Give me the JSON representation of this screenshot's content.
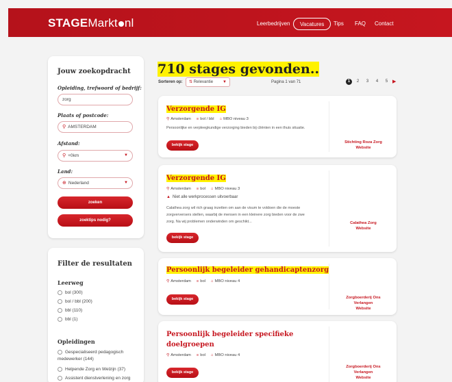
{
  "header": {
    "logo_bold": "STAGE",
    "logo_thin": "Markt",
    "logo_suffix": "nl",
    "nav": [
      "Leerbedrijven",
      "Vacatures",
      "Tips",
      "FAQ",
      "Contact"
    ]
  },
  "search": {
    "title": "Jouw zoekopdracht",
    "q_label": "Opleiding, trefwoord of bedrijf:",
    "q_value": "zorg",
    "place_label": "Plaats of postcode:",
    "place_value": "AMSTERDAM",
    "dist_label": "Afstand:",
    "dist_value": "+0km",
    "country_label": "Land:",
    "country_value": "Nederland",
    "search_btn": "zoeken",
    "tips_btn": "zoektips nodig?"
  },
  "filter": {
    "title": "Filter de resultaten",
    "leerweg_title": "Leerweg",
    "leerweg": [
      "bol (300)",
      "bol / bbl (200)",
      "bbl (110)",
      "bbl (1)"
    ],
    "opleidingen_title": "Opleidingen",
    "opleidingen": [
      "Gespecialiseerd pedagogisch medewerker (144)",
      "Helpende Zorg en Welzijn (37)",
      "Assistent dienstverlening en zorg"
    ]
  },
  "results": {
    "count_title": "710 stages gevonden..",
    "sort_label": "Sorteren op:",
    "sort_value": "Relevantie",
    "pagina": "Pagina 1 van 71",
    "pages": [
      "1",
      "2",
      "3",
      "4",
      "5"
    ],
    "next": "▶"
  },
  "cards": [
    {
      "title": "Verzorgende IG",
      "city": "Amsterdam",
      "leerweg": "bol / bbl",
      "niveau": "MBO niveau 3",
      "desc": "Persoonlijke en verpleegkundige verzorging bieden bij cliënten in een thuis situatie.",
      "btn": "bekijk stage",
      "org1": "Stichting Roza Zorg",
      "org2": "Website"
    },
    {
      "title": "Verzorgende IG",
      "city": "Amsterdam",
      "leerweg": "bol",
      "niveau": "MBO niveau 3",
      "warn": "Niet alle werkprocessen uitvoerbaar",
      "desc": "Calathea zorg wil rich graag inzetten om aan de visum te voldoen die de moeste zorgverversers stellen, waarbij de mensen in een kleinere zorg bieden voor de zwe zorg. Na wij problemen onderwinden om geschikt...",
      "btn": "bekijk stage",
      "org1": "Calathea Zorg",
      "org2": "Website"
    },
    {
      "title": "Persoonlijk begeleider gehandicaptenzorg",
      "city": "Amsterdam",
      "leerweg": "bol",
      "niveau": "MBO niveau 4",
      "btn": "bekijk stage",
      "org1": "Zorgboerderij Ons",
      "org2": "Verlangen",
      "org3": "Website"
    },
    {
      "title1": "Persoonlijk begeleider specifieke",
      "title2": "doelgroepen",
      "city": "Amsterdam",
      "leerweg": "bol",
      "niveau": "MBO niveau 4",
      "btn": "bekijk stage",
      "org1": "Zorgboerderij Ons",
      "org2": "Verlangen",
      "org3": "Website"
    }
  ],
  "icons": {
    "pin": "⚲",
    "school": "≡",
    "cap": "⌂",
    "warn": "▲",
    "globe": "⊕"
  },
  "colors": {
    "brand_red": "#c6161f",
    "highlight": "#fff200"
  }
}
